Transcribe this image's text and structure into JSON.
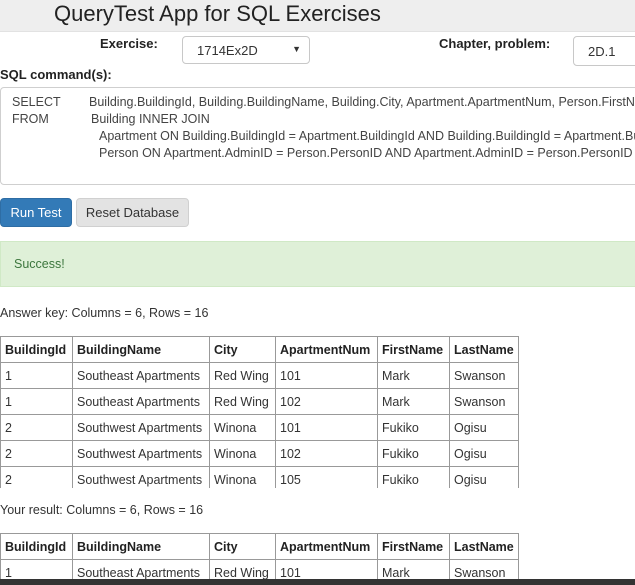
{
  "header": {
    "title": "QueryTest App for SQL Exercises"
  },
  "form": {
    "exercise_label": "Exercise:",
    "exercise_value": "1714Ex2D",
    "chapter_label": "Chapter, problem:",
    "chapter_value": "2D.1",
    "sql_label": "SQL command(s):"
  },
  "sql": {
    "lines": [
      {
        "keyword": "SELECT",
        "text": "Building.BuildingId, Building.BuildingName, Building.City, Apartment.ApartmentNum, Person.FirstName, Person.LastName"
      },
      {
        "keyword": "FROM",
        "text": "Building INNER JOIN"
      },
      {
        "keyword": "",
        "text": "Apartment ON Building.BuildingId = Apartment.BuildingId AND Building.BuildingId = Apartment.BuildingId"
      },
      {
        "keyword": "",
        "text": "Person ON Apartment.AdminID = Person.PersonID AND Apartment.AdminID = Person.PersonID"
      }
    ]
  },
  "buttons": {
    "run": "Run Test",
    "reset": "Reset Database"
  },
  "status": {
    "message": "Success!",
    "color": "#3c763d",
    "background": "#dff0d8"
  },
  "answer_key": {
    "summary": "Answer key: Columns = 6, Rows = 16",
    "columns": [
      "BuildingId",
      "BuildingName",
      "City",
      "ApartmentNum",
      "FirstName",
      "LastName"
    ],
    "rows": [
      [
        "1",
        "Southeast Apartments",
        "Red Wing",
        "101",
        "Mark",
        "Swanson"
      ],
      [
        "1",
        "Southeast Apartments",
        "Red Wing",
        "102",
        "Mark",
        "Swanson"
      ],
      [
        "2",
        "Southwest Apartments",
        "Winona",
        "101",
        "Fukiko",
        "Ogisu"
      ],
      [
        "2",
        "Southwest Apartments",
        "Winona",
        "102",
        "Fukiko",
        "Ogisu"
      ],
      [
        "2",
        "Southwest Apartments",
        "Winona",
        "105",
        "Fukiko",
        "Ogisu"
      ]
    ]
  },
  "your_result": {
    "summary": "Your result: Columns = 6, Rows = 16",
    "columns": [
      "BuildingId",
      "BuildingName",
      "City",
      "ApartmentNum",
      "FirstName",
      "LastName"
    ],
    "rows": [
      [
        "1",
        "Southeast Apartments",
        "Red Wing",
        "101",
        "Mark",
        "Swanson"
      ]
    ]
  },
  "colors": {
    "primary_button": "#337ab7",
    "header_bg": "#eeeeee"
  }
}
